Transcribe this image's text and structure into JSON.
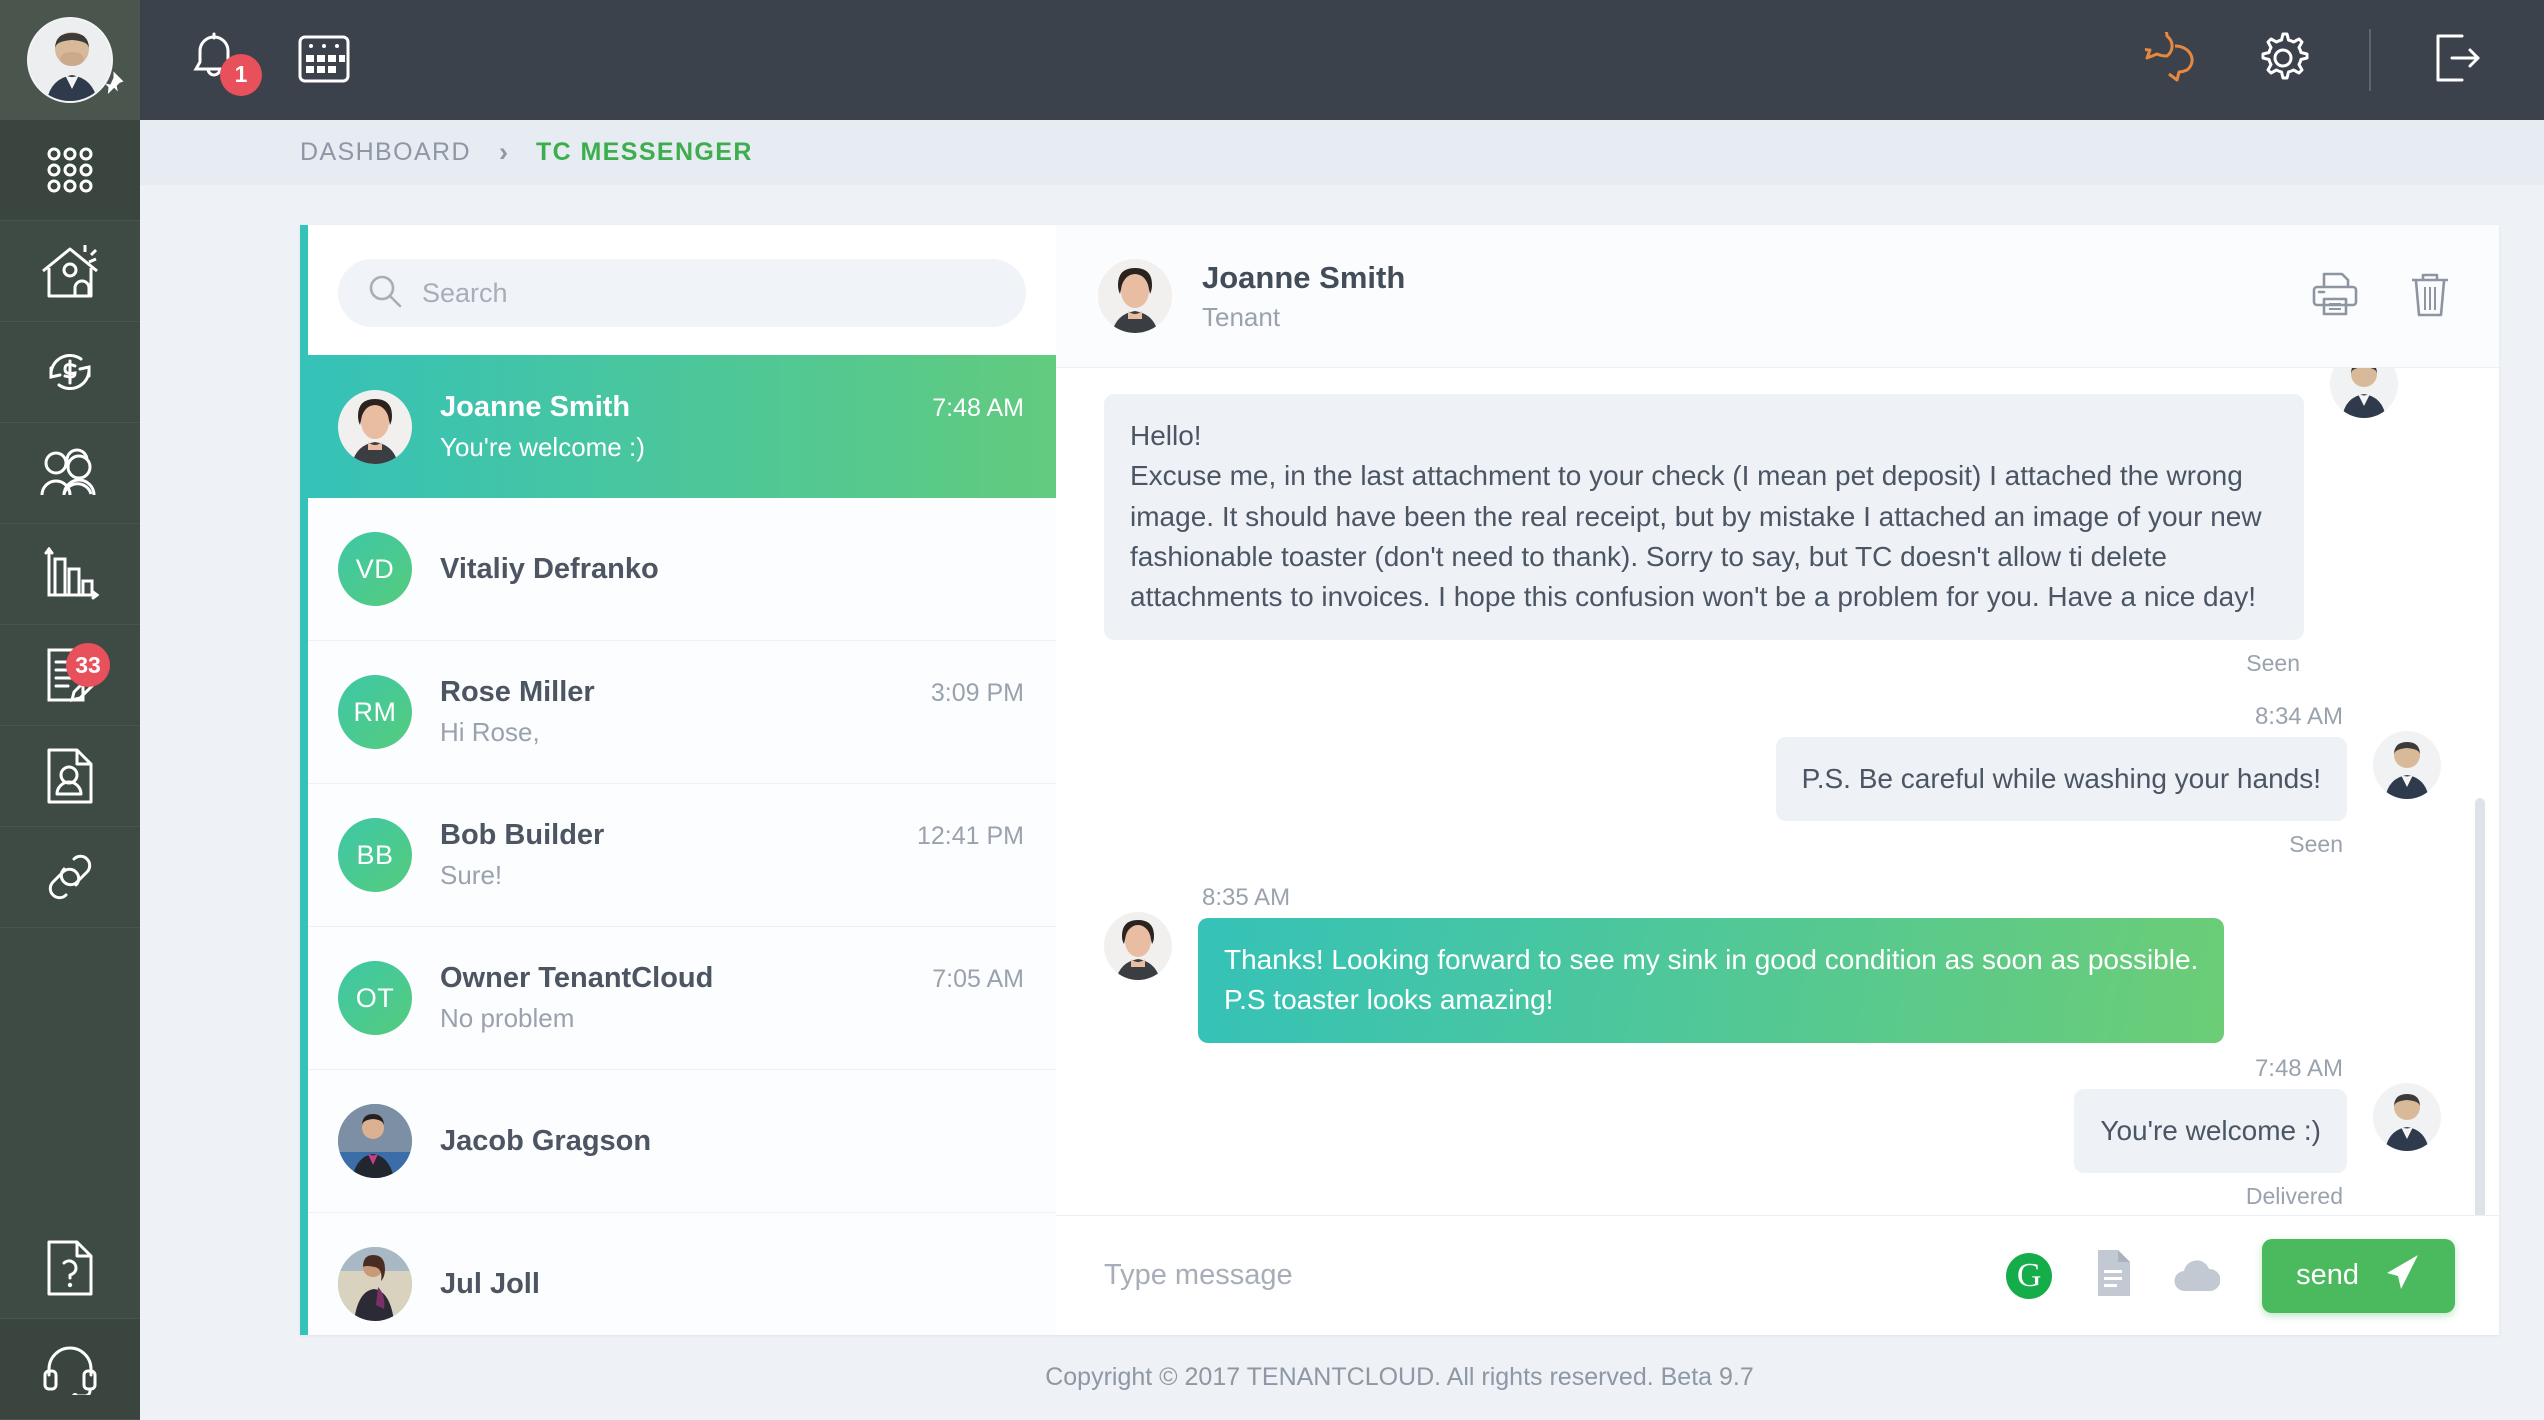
{
  "rail": {
    "avatar_alt": "user-avatar",
    "items": [
      {
        "icon": "apps-grid-icon",
        "label": "Apps"
      },
      {
        "icon": "home-property-icon",
        "label": "Properties"
      },
      {
        "icon": "dollar-refresh-icon",
        "label": "Payments"
      },
      {
        "icon": "people-icon",
        "label": "Tenants"
      },
      {
        "icon": "bar-chart-icon",
        "label": "Reports"
      },
      {
        "icon": "document-edit-icon",
        "label": "Maintenance",
        "badge": "33"
      },
      {
        "icon": "person-document-icon",
        "label": "Applications"
      },
      {
        "icon": "link-icon",
        "label": "Links"
      },
      {
        "icon": "question-document-icon",
        "label": "Help"
      },
      {
        "icon": "headset-icon",
        "label": "Support"
      }
    ]
  },
  "topbar": {
    "notifications_icon": "bell-icon",
    "notifications_count": "1",
    "calendar_icon": "calendar-icon",
    "messenger_icon": "chat-bubbles-icon",
    "settings_icon": "gear-icon",
    "logout_icon": "logout-icon"
  },
  "breadcrumb": {
    "root": "DASHBOARD",
    "separator": "›",
    "current": "TC MESSENGER"
  },
  "search": {
    "placeholder": "Search",
    "value": "",
    "icon": "search-icon"
  },
  "conversations": [
    {
      "name": "Joanne Smith",
      "snippet": "You're welcome :)",
      "time": "7:48 AM",
      "avatar_type": "photo-woman",
      "initials": "",
      "active": true
    },
    {
      "name": "Vitaliy Defranko",
      "snippet": "",
      "time": "",
      "avatar_type": "initials",
      "initials": "VD",
      "active": false
    },
    {
      "name": "Rose Miller",
      "snippet": "Hi Rose,",
      "time": "3:09 PM",
      "avatar_type": "initials",
      "initials": "RM",
      "active": false
    },
    {
      "name": "Bob Builder",
      "snippet": "Sure!",
      "time": "12:41 PM",
      "avatar_type": "initials",
      "initials": "BB",
      "active": false
    },
    {
      "name": "Owner TenantCloud",
      "snippet": "No problem",
      "time": "7:05 AM",
      "avatar_type": "initials",
      "initials": "OT",
      "active": false
    },
    {
      "name": "Jacob Gragson",
      "snippet": "",
      "time": "",
      "avatar_type": "photo-man2",
      "initials": "",
      "active": false
    },
    {
      "name": "Jul Joll",
      "snippet": "",
      "time": "",
      "avatar_type": "photo-woman2",
      "initials": "",
      "active": false
    }
  ],
  "chat_header": {
    "name": "Joanne Smith",
    "role": "Tenant",
    "print_icon": "printer-icon",
    "delete_icon": "trash-icon"
  },
  "messages": [
    {
      "direction": "in",
      "time": "",
      "text": "Hello!\nExcuse me, in the last attachment to your check (I mean pet deposit) I attached the wrong image. It should have been the real receipt, but by mistake I attached an image of your new fashionable toaster (don't need to thank). Sorry to say, but TC doesn't allow ti delete attachments to invoices. I hope this confusion won't be a problem for you. Have a nice day!",
      "status": "Seen",
      "bubble": "grey"
    },
    {
      "direction": "out",
      "time": "8:34 AM",
      "text": "P.S. Be careful while washing your hands!",
      "status": "Seen",
      "bubble": "grey"
    },
    {
      "direction": "in",
      "time": "8:35 AM",
      "text": "Thanks! Looking forward to see my sink in good condition as soon as possible.\nP.S toaster looks amazing!",
      "status": "",
      "bubble": "green"
    },
    {
      "direction": "out",
      "time": "7:48 AM",
      "text": "You're welcome :)",
      "status": "Delivered",
      "bubble": "grey"
    }
  ],
  "composer": {
    "placeholder": "Type message",
    "value": "",
    "grammarly_icon": "grammarly-icon",
    "grammarly_glyph": "G",
    "template_icon": "document-icon",
    "upload_icon": "cloud-upload-icon",
    "send_label": "send",
    "send_icon": "paper-plane-icon"
  },
  "footer": {
    "text": "Copyright © 2017 TENANTCLOUD. All rights reserved. Beta 9.7"
  },
  "colors": {
    "rail_bg": "#3e4a44",
    "topbar_bg": "#3c424b",
    "accent_green": "#3cae4d",
    "accent_teal": "#35c2b8",
    "badge_red": "#e8505b",
    "messenger_orange": "#e8883f"
  }
}
